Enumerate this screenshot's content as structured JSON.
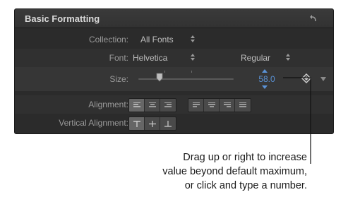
{
  "panel": {
    "title": "Basic Formatting",
    "reset_icon": "reset-arrow-icon"
  },
  "rows": {
    "collection": {
      "label": "Collection:",
      "value": "All Fonts"
    },
    "font": {
      "label": "Font:",
      "family": "Helvetica",
      "style": "Regular"
    },
    "size": {
      "label": "Size:",
      "value": "58.0",
      "slider_level": 0.22,
      "value_color": "#5a92d6"
    },
    "alignment": {
      "label": "Alignment:"
    },
    "vertical_alignment": {
      "label": "Vertical Alignment:"
    }
  },
  "icons": {
    "updown": "up-down-arrows-icon",
    "keyframe": "keyframe-diamond-icon",
    "menu": "chevron-down-icon"
  },
  "caption": {
    "line1": "Drag up or right to increase",
    "line2": "value beyond default maximum,",
    "line3": "or click and type a number."
  }
}
